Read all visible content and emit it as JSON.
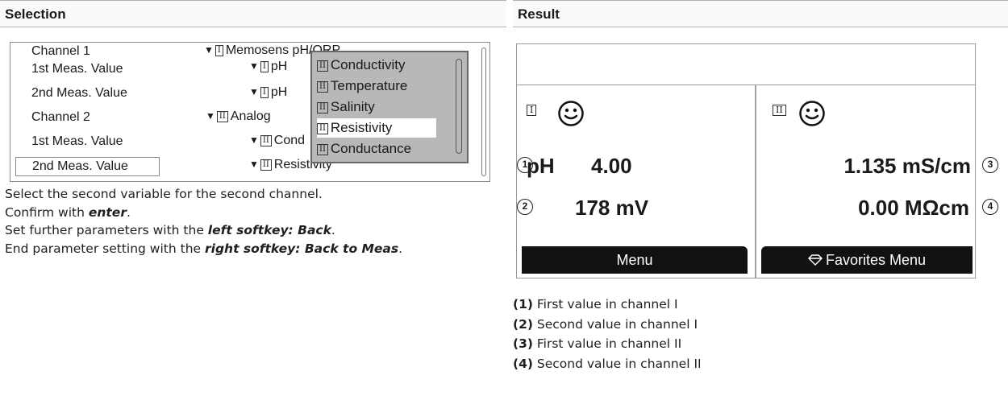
{
  "headers": {
    "selection": "Selection",
    "result": "Result"
  },
  "selection": {
    "rows": [
      {
        "label": "Channel 1",
        "value": "Memosens pH/ORP",
        "chan": "I"
      },
      {
        "label": "1st Meas. Value",
        "value": "pH",
        "chan": "I"
      },
      {
        "label": "2nd Meas. Value",
        "value": "pH",
        "chan": "I"
      },
      {
        "label": "Channel 2",
        "value": "Analog",
        "chan": "II"
      },
      {
        "label": "1st Meas. Value",
        "value": "Cond",
        "chan": "II"
      },
      {
        "label": "2nd Meas. Value",
        "value": "Resistivity",
        "chan": "II"
      }
    ],
    "dropdown": {
      "options": [
        "Conductivity",
        "Temperature",
        "Salinity",
        "Resistivity",
        "Conductance"
      ],
      "chan": "II",
      "selected": "Resistivity"
    }
  },
  "instructions": {
    "line1": "Select the second variable for the second channel.",
    "line2_pre": "Confirm with ",
    "line2_key": "enter",
    "line2_post": ".",
    "line3_pre": "Set further parameters with the ",
    "line3_key": "left softkey: Back",
    "line3_post": ".",
    "line4_pre": "End parameter setting with the ",
    "line4_key": "right softkey: Back to Meas",
    "line4_post": "."
  },
  "device": {
    "left": {
      "channel": "I",
      "param": "pH",
      "value1": "4.00",
      "value2": "178 mV",
      "softkey": "Menu"
    },
    "right": {
      "channel": "II",
      "value1": "1.135 mS/cm",
      "value2": "0.00 MΩcm",
      "softkey": "Favorites Menu",
      "softkey_icon": "diamond-icon"
    },
    "callouts": [
      "1",
      "2",
      "3",
      "4"
    ]
  },
  "legend": [
    {
      "num": "(1)",
      "text": "First value in channel I"
    },
    {
      "num": "(2)",
      "text": "Second value in channel I"
    },
    {
      "num": "(3)",
      "text": "First value in channel II"
    },
    {
      "num": "(4)",
      "text": "Second value in channel II"
    }
  ]
}
